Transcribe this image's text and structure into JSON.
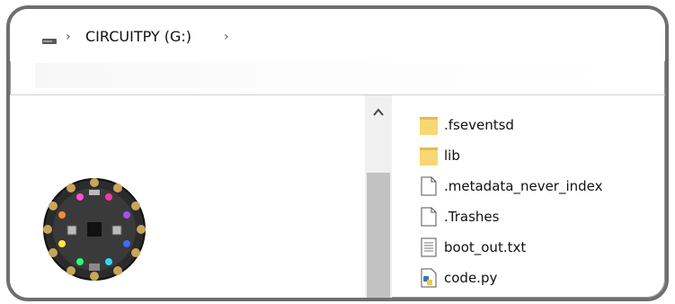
{
  "window": {
    "breadcrumb": {
      "root_icon": "drive-icon",
      "separator": "›",
      "location": "CIRCUITPY (G:)"
    }
  },
  "file_list": {
    "items": [
      {
        "name": ".fseventsd",
        "icon": "folder-icon"
      },
      {
        "name": "lib",
        "icon": "folder-icon"
      },
      {
        "name": ".metadata_never_index",
        "icon": "file-icon"
      },
      {
        "name": ".Trashes",
        "icon": "file-icon"
      },
      {
        "name": "boot_out.txt",
        "icon": "text-file-icon"
      },
      {
        "name": "code.py",
        "icon": "python-file-icon"
      }
    ]
  },
  "colors": {
    "folder": "#f8d775",
    "folder_dark": "#e6b94f",
    "frame": "#6f6f6f",
    "board": "#222222"
  }
}
